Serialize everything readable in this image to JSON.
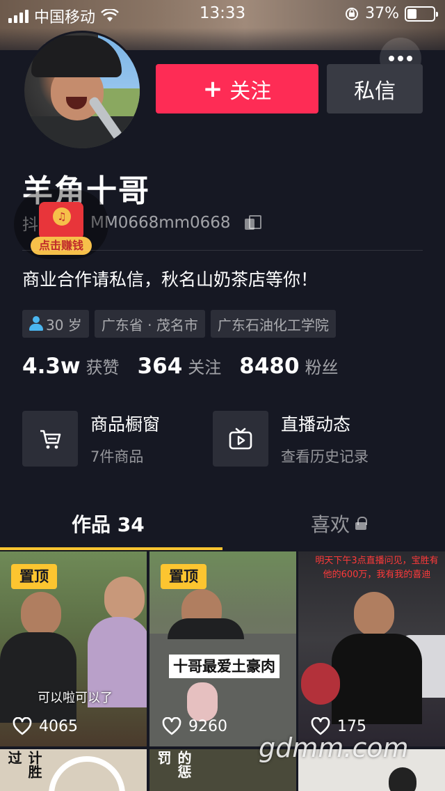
{
  "status_bar": {
    "carrier": "中国移动",
    "time": "13:33",
    "battery_percent": "37%",
    "battery_level": 0.37
  },
  "profile": {
    "name": "羊角十哥",
    "uid_prefix": "抖",
    "uid": "MM0668mm0668",
    "earn_badge_label": "点击赚钱",
    "bio": "商业合作请私信，秋名山奶茶店等你！",
    "tags": [
      "30 岁",
      "广东省 · 茂名市",
      "广东石油化工学院"
    ]
  },
  "actions": {
    "follow_plus": "+",
    "follow_label": "关注",
    "message_label": "私信"
  },
  "stats": [
    {
      "value": "4.3w",
      "label": "获赞"
    },
    {
      "value": "364",
      "label": "关注"
    },
    {
      "value": "8480",
      "label": "粉丝"
    }
  ],
  "features": {
    "shop": {
      "title": "商品橱窗",
      "subtitle": "7件商品",
      "icon": "cart-icon"
    },
    "live": {
      "title": "直播动态",
      "subtitle": "查看历史记录",
      "icon": "tv-icon"
    }
  },
  "tabs": {
    "works": "作品 34",
    "likes": "喜欢"
  },
  "videos": [
    {
      "pinned": "置顶",
      "caption": "可以啦可以了",
      "likes": "4065"
    },
    {
      "pinned": "置顶",
      "caption": "十哥最爱土豪肉",
      "likes": "9260"
    },
    {
      "pinned": "",
      "caption": "明天下午3点直播问见，宝胜有他的600万，我有我的喜迪",
      "likes": "175"
    }
  ],
  "partial_row_text": [
    "计胜过",
    "的惩罚"
  ],
  "watermark": "gdmm.com",
  "colors": {
    "background": "#161823",
    "follow_button": "#fe2c55",
    "tab_indicator": "#fcc530",
    "pin_badge": "#fcc530"
  }
}
